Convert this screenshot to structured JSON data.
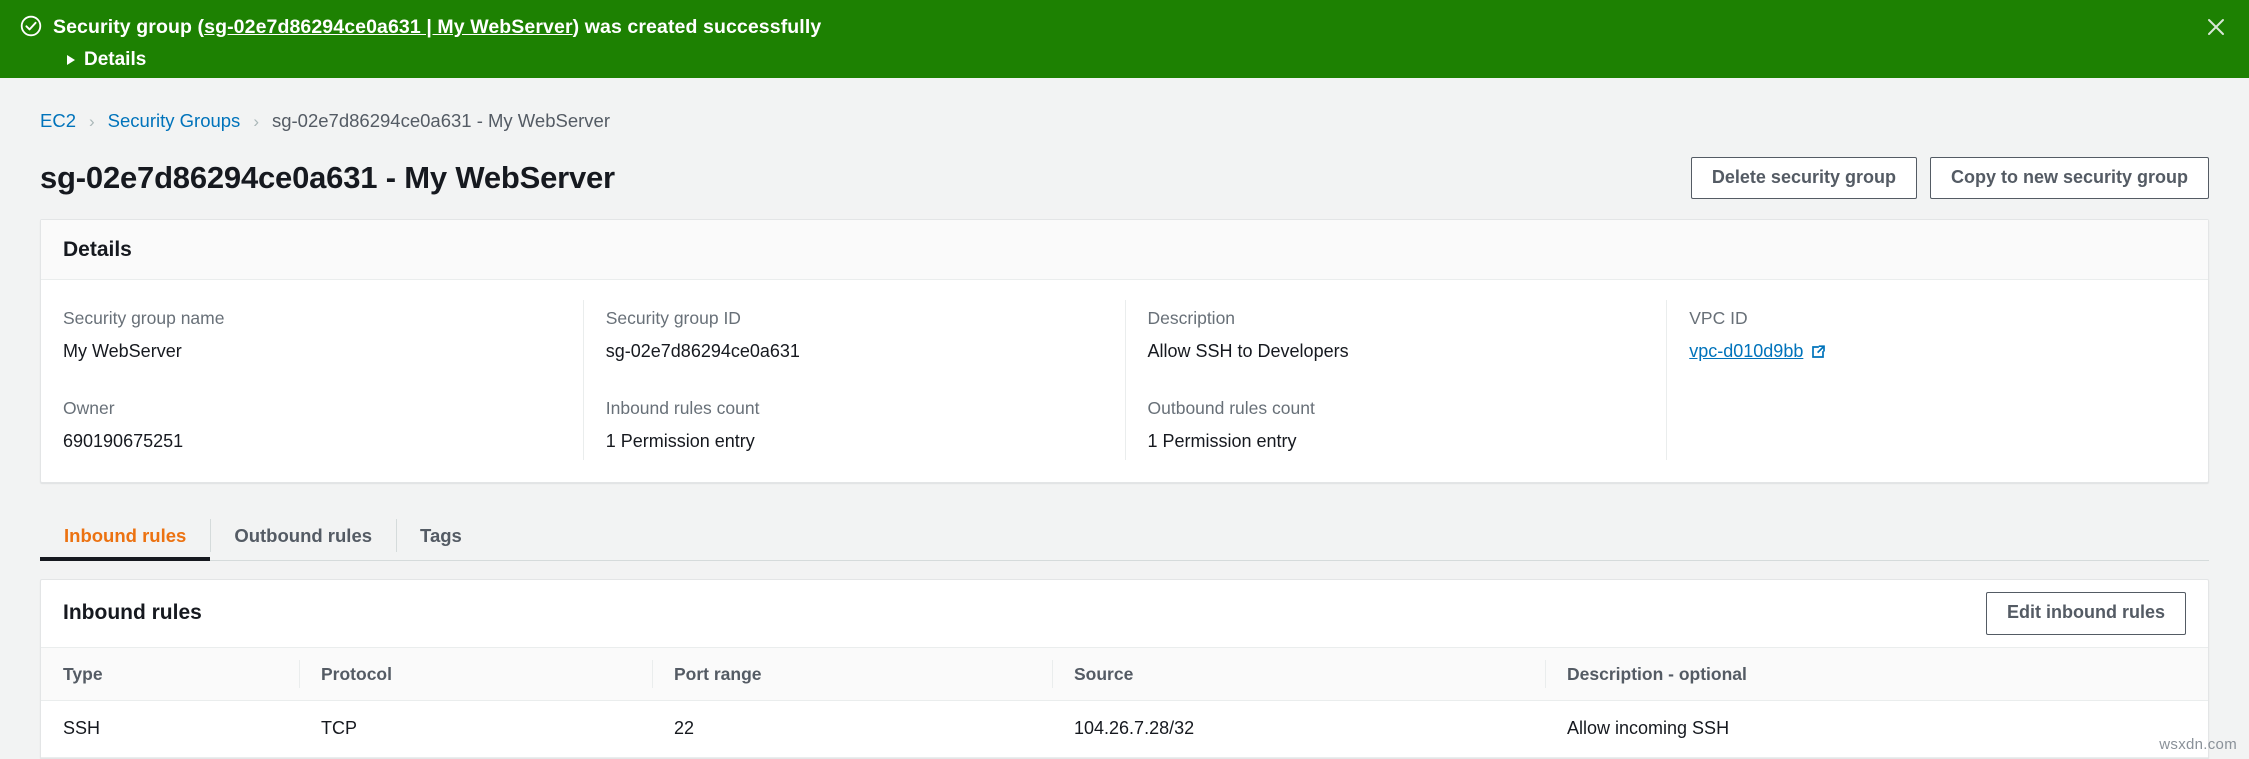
{
  "flash": {
    "icon": "check-circle-icon",
    "message_prefix": "Security group (",
    "message_link": "sg-02e7d86294ce0a631 | My WebServer",
    "message_suffix": ") was created successfully",
    "details_label": "Details",
    "close_icon": "close-icon",
    "background_color": "#1d8102"
  },
  "breadcrumb": {
    "items": [
      {
        "label": "EC2",
        "link": true
      },
      {
        "label": "Security Groups",
        "link": true
      },
      {
        "label": "sg-02e7d86294ce0a631 - My WebServer",
        "link": false
      }
    ],
    "separator": "›"
  },
  "header": {
    "title": "sg-02e7d86294ce0a631 - My WebServer",
    "delete_button": "Delete security group",
    "copy_button": "Copy to new security group"
  },
  "details": {
    "title": "Details",
    "fields": [
      {
        "label": "Security group name",
        "value": "My WebServer",
        "link": false
      },
      {
        "label": "Security group ID",
        "value": "sg-02e7d86294ce0a631",
        "link": false
      },
      {
        "label": "Description",
        "value": "Allow SSH to Developers",
        "link": false
      },
      {
        "label": "VPC ID",
        "value": "vpc-d010d9bb",
        "link": true,
        "icon": "external-link-icon"
      },
      {
        "label": "Owner",
        "value": "690190675251",
        "link": false
      },
      {
        "label": "Inbound rules count",
        "value": "1 Permission entry",
        "link": false
      },
      {
        "label": "Outbound rules count",
        "value": "1 Permission entry",
        "link": false
      },
      {
        "label": "",
        "value": "",
        "link": false
      }
    ]
  },
  "tabs": [
    {
      "label": "Inbound rules",
      "active": true
    },
    {
      "label": "Outbound rules",
      "active": false
    },
    {
      "label": "Tags",
      "active": false
    }
  ],
  "inbound_rules": {
    "title": "Inbound rules",
    "edit_button": "Edit inbound rules",
    "columns": [
      "Type",
      "Protocol",
      "Port range",
      "Source",
      "Description - optional"
    ],
    "rows": [
      {
        "type": "SSH",
        "protocol": "TCP",
        "port_range": "22",
        "source": "104.26.7.28/32",
        "description": "Allow incoming SSH"
      }
    ]
  },
  "watermark": "wsxdn.com",
  "colors": {
    "success_green": "#1d8102",
    "link_blue": "#0073bb",
    "active_tab_orange": "#ec7211",
    "page_background": "#f2f3f3"
  }
}
